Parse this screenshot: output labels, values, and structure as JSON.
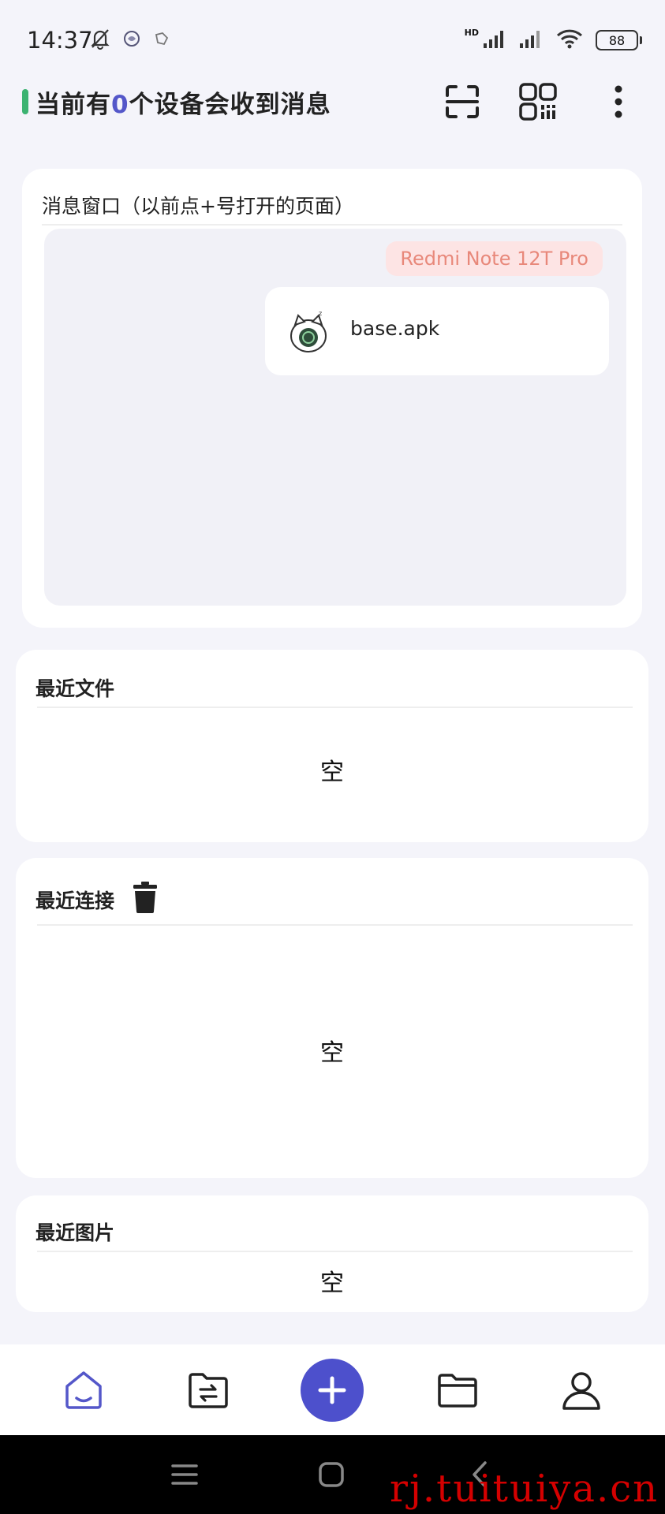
{
  "status_bar": {
    "time": "14:37",
    "hd_label": "HD",
    "battery": "88"
  },
  "header": {
    "title_prefix": "当前有",
    "device_count": "0",
    "title_suffix": "个设备会收到消息",
    "accent_color": "#5457c9"
  },
  "message_window": {
    "title": "消息窗口（以前点+号打开的页面）",
    "device_tag": "Redmi Note 12T Pro",
    "file_name": "base.apk"
  },
  "recent_files": {
    "title": "最近文件",
    "empty_text": "空"
  },
  "recent_connections": {
    "title": "最近连接",
    "empty_text": "空"
  },
  "recent_images": {
    "title": "最近图片",
    "empty_text": "空"
  },
  "watermark": "rj.tuituiya.cn"
}
